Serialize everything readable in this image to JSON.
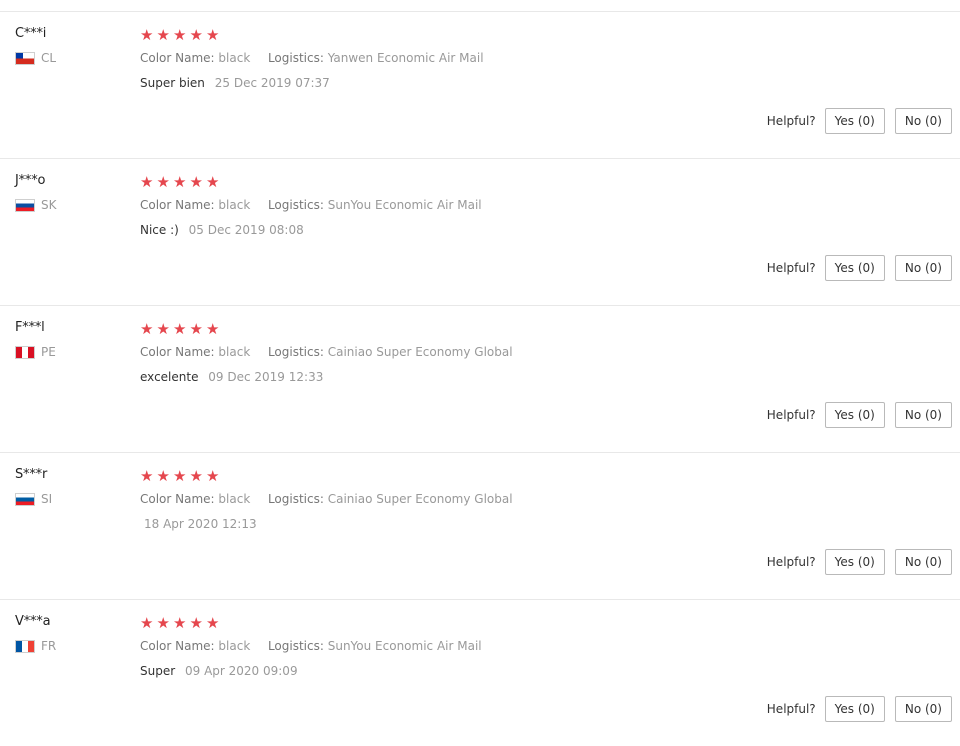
{
  "labels": {
    "color_name": "Color Name:",
    "logistics": "Logistics:",
    "helpful": "Helpful?",
    "yes_button": "Yes (0)",
    "no_button": "No (0)"
  },
  "colors": {
    "star": "#e5474e",
    "border": "#e8e8e8"
  },
  "reviews": [
    {
      "user": "C***i",
      "country": "CL",
      "flag_icon": "chile-flag-icon",
      "rating": 5,
      "color_name": "black",
      "logistics": "Yanwen Economic Air Mail",
      "text": "Super bien",
      "date": "25 Dec 2019 07:37"
    },
    {
      "user": "J***o",
      "country": "SK",
      "flag_icon": "slovakia-flag-icon",
      "rating": 5,
      "color_name": "black",
      "logistics": "SunYou Economic Air Mail",
      "text": "Nice :)",
      "date": "05 Dec 2019 08:08"
    },
    {
      "user": "F***l",
      "country": "PE",
      "flag_icon": "peru-flag-icon",
      "rating": 5,
      "color_name": "black",
      "logistics": "Cainiao Super Economy Global",
      "text": "excelente",
      "date": "09 Dec 2019 12:33"
    },
    {
      "user": "S***r",
      "country": "SI",
      "flag_icon": "slovenia-flag-icon",
      "rating": 5,
      "color_name": "black",
      "logistics": "Cainiao Super Economy Global",
      "text": "",
      "date": "18 Apr 2020 12:13"
    },
    {
      "user": "V***a",
      "country": "FR",
      "flag_icon": "france-flag-icon",
      "rating": 5,
      "color_name": "black",
      "logistics": "SunYou Economic Air Mail",
      "text": "Super",
      "date": "09 Apr 2020 09:09"
    }
  ]
}
